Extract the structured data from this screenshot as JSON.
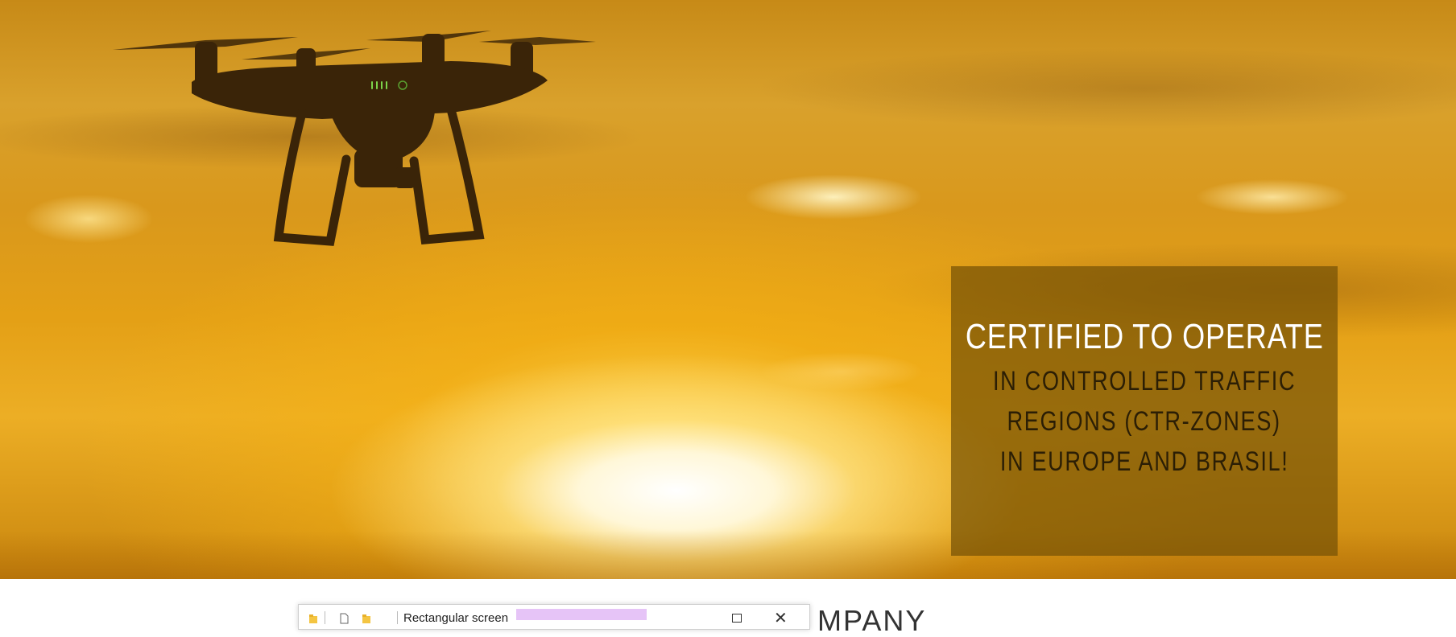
{
  "hero": {
    "overlay": {
      "title": "CERTIFIED TO OPERATE",
      "lines": [
        "IN CONTROLLED TRAFFIC",
        "REGIONS (CTR-ZONES)",
        "IN EUROPE AND BRASIL!"
      ]
    },
    "image": "drone-silhouette-at-sunset"
  },
  "section": {
    "heading_partial": "MPANY"
  },
  "snip_toolbar": {
    "mode_label": "Rectangular screen",
    "icons": [
      "folder-icon",
      "new-document-icon",
      "folder-icon",
      "maximize-icon",
      "close-icon"
    ]
  },
  "colors": {
    "overlay_bg": "#765206",
    "overlay_title": "#ffffff",
    "overlay_text": "#2b1e05",
    "sky_orange": "#e4a016"
  }
}
